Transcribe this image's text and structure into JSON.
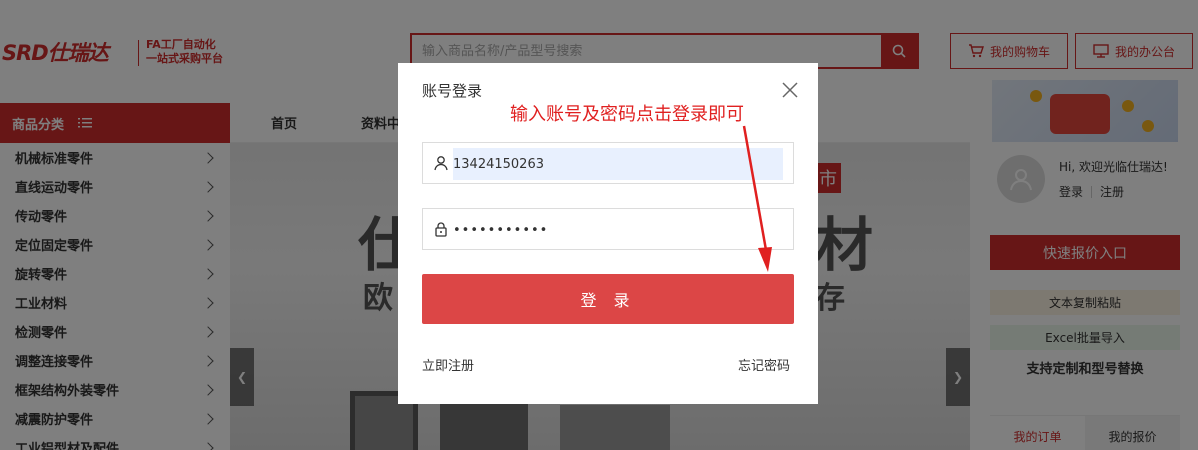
{
  "header": {
    "logo_text": "SRD仕瑞达",
    "slogan_line1": "FA工厂自动化",
    "slogan_line2": "一站式采购平台",
    "search_placeholder": "输入商品名称/产品型号搜索",
    "cart_label": "我的购物车",
    "office_label": "我的办公台"
  },
  "nav": {
    "category_title": "商品分类",
    "items": [
      "首页",
      "资料中"
    ]
  },
  "categories": [
    "机械标准零件",
    "直线运动零件",
    "传动零件",
    "定位固定零件",
    "旋转零件",
    "工业材料",
    "检测零件",
    "调整连接零件",
    "框架结构外装零件",
    "减震防护零件",
    "工业铝型材及配件"
  ],
  "banner": {
    "big_left": "仕",
    "big_right": "材",
    "small_left": "欧",
    "small_right": "存",
    "tag": "市"
  },
  "sidebar_right": {
    "welcome": "Hi, 欢迎光临仕瑞达!",
    "login": "登录",
    "register": "注册",
    "quick_quote": "快速报价入口",
    "text_paste": "文本复制粘贴",
    "excel_import": "Excel批量导入",
    "support_text": "支持定制和型号替换",
    "tab_orders": "我的订单",
    "tab_quotes": "我的报价"
  },
  "modal": {
    "title": "账号登录",
    "username": "13424150263",
    "password_mask": "•••••••••••",
    "login_button": "登 录",
    "register_link": "立即注册",
    "forgot_link": "忘记密码"
  },
  "annotation": {
    "text": "输入账号及密码点击登录即可",
    "color": "#e02020"
  },
  "colors": {
    "brand_red": "#cf2d2d",
    "login_button": "#dc4646"
  }
}
